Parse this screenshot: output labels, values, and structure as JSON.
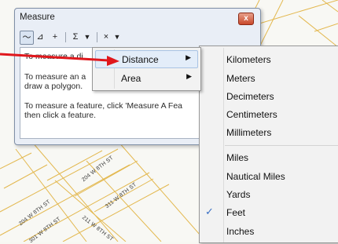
{
  "map": {
    "street_labels": [
      "204 W 8TH ST",
      "311 W 8TH ST",
      "204 W 8TH ST",
      "211 W 8TH ST",
      "301 W 8TH ST"
    ]
  },
  "measure_window": {
    "title": "Measure",
    "close_glyph": "x",
    "toolbar": {
      "line_tool": "〜",
      "polygon_tool": "⊿",
      "point_tool": "+",
      "sum_tool": "Σ",
      "sum_dropdown": "▼",
      "clear_tool": "×",
      "clear_dropdown": "▼"
    },
    "help_lines": [
      "To measure a di",
      "To measure an a",
      "draw a polygon.",
      "To measure a feature, click 'Measure A Fea",
      "then click a feature."
    ]
  },
  "menu": {
    "items": [
      {
        "label": "Distance",
        "arrow": "▶"
      },
      {
        "label": "Area",
        "arrow": "▶"
      }
    ]
  },
  "units_menu": {
    "metric": [
      "Kilometers",
      "Meters",
      "Decimeters",
      "Centimeters",
      "Millimeters"
    ],
    "imperial": [
      "Miles",
      "Nautical Miles",
      "Yards",
      "Feet",
      "Inches"
    ],
    "checked_unit": "Feet",
    "check_glyph": "✓"
  },
  "colors": {
    "parcel_line": "#e3b84f",
    "pointer_arrow": "#e0171c",
    "menu_highlight": "#e3edf9"
  }
}
